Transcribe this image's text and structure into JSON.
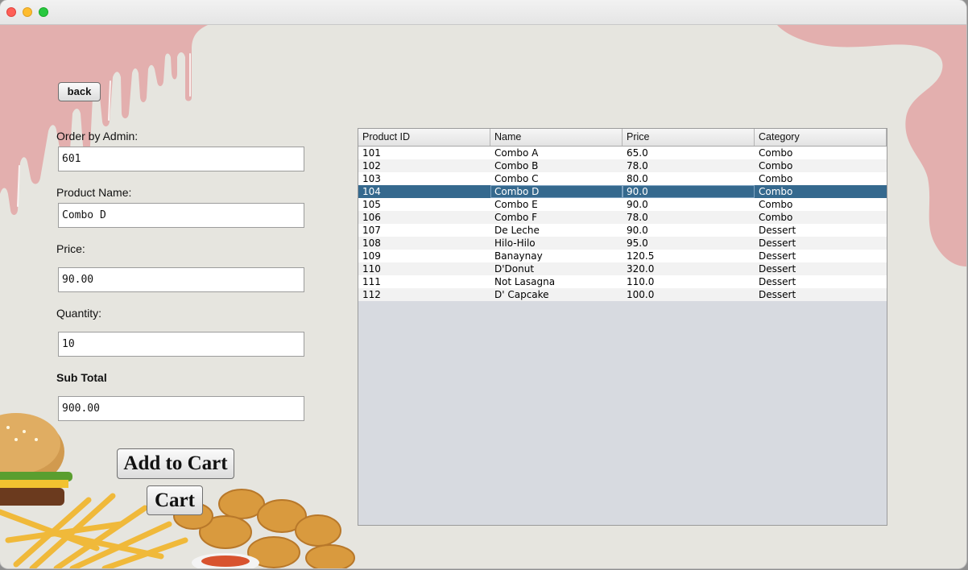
{
  "window": {
    "colors": {
      "background": "#e6e5df",
      "drip": "#e3afae",
      "selection": "#35698e"
    }
  },
  "back_button": "back",
  "form": {
    "order_label": "Order by Admin:",
    "order_value": "601",
    "product_label": "Product Name:",
    "product_value": "Combo D",
    "price_label": "Price:",
    "price_value": "90.00",
    "quantity_label": "Quantity:",
    "quantity_value": "10",
    "subtotal_label": "Sub Total",
    "subtotal_value": "900.00"
  },
  "buttons": {
    "add_to_cart": "Add to Cart",
    "cart": "Cart"
  },
  "table": {
    "headers": [
      "Product ID",
      "Name",
      "Price",
      "Category"
    ],
    "rows": [
      [
        "101",
        "Combo A",
        "65.0",
        "Combo"
      ],
      [
        "102",
        "Combo B",
        "78.0",
        "Combo"
      ],
      [
        "103",
        "Combo C",
        "80.0",
        "Combo"
      ],
      [
        "104",
        "Combo D",
        "90.0",
        "Combo"
      ],
      [
        "105",
        "Combo E",
        "90.0",
        "Combo"
      ],
      [
        "106",
        "Combo F",
        "78.0",
        "Combo"
      ],
      [
        "107",
        "De Leche",
        "90.0",
        "Dessert"
      ],
      [
        "108",
        "Hilo-Hilo",
        "95.0",
        "Dessert"
      ],
      [
        "109",
        "Banaynay",
        "120.5",
        "Dessert"
      ],
      [
        "110",
        "D'Donut",
        "320.0",
        "Dessert"
      ],
      [
        "111",
        "Not Lasagna",
        "110.0",
        "Dessert"
      ],
      [
        "112",
        "D' Capcake",
        "100.0",
        "Dessert"
      ]
    ],
    "selected_index": 3
  }
}
